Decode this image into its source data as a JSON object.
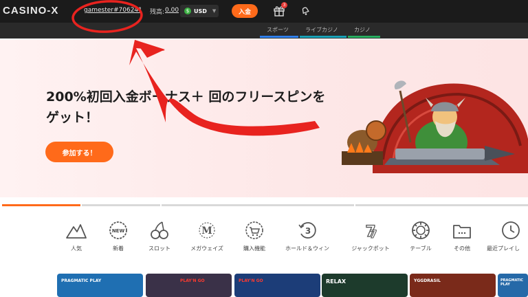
{
  "header": {
    "logo": "CASINO-X",
    "username": "gamester#706241",
    "balance_label": "残高:",
    "balance_value": "0.00",
    "currency_symbol": "$",
    "currency": "USD",
    "deposit_label": "入金",
    "gift_badge": "3"
  },
  "subnav": {
    "tabs": [
      {
        "label": "スポーツ",
        "color": "#2f80ed"
      },
      {
        "label": "ライブカジノ",
        "color": "#17a2b8"
      },
      {
        "label": "カジノ",
        "color": "#27ae60"
      }
    ]
  },
  "hero": {
    "title": "200%初回入金ボーナス＋ 回のフリースピンをゲット！",
    "cta_label": "参加する！",
    "slides": 4,
    "active_slide": 1
  },
  "categories": [
    {
      "label": "人気",
      "icon": "mountain-icon"
    },
    {
      "label": "新着",
      "icon": "new-badge-icon"
    },
    {
      "label": "スロット",
      "icon": "cherry-icon"
    },
    {
      "label": "メガウェイズ",
      "icon": "megaways-icon"
    },
    {
      "label": "購入機能",
      "icon": "cart-icon"
    },
    {
      "label": "ホールド＆ウィン",
      "icon": "hold-win-icon"
    },
    {
      "label": "ジャックポット",
      "icon": "jackpot-777-icon"
    },
    {
      "label": "テーブル",
      "icon": "chip-icon"
    },
    {
      "label": "その他",
      "icon": "folder-icon"
    },
    {
      "label": "最近プレイし",
      "icon": "history-clock-icon"
    }
  ],
  "games": [
    {
      "provider": "PRAGMATIC PLAY",
      "color": "#1f6fb2"
    },
    {
      "provider": "PLAY'N GO",
      "color": "#3a3148"
    },
    {
      "provider": "PLAY'N GO",
      "color": "#1c3d78"
    },
    {
      "provider": "RELAX",
      "color": "#1d3b2c"
    },
    {
      "provider": "YGGDRASIL",
      "color": "#7a2a1a"
    },
    {
      "provider": "PRAGMATIC PLAY",
      "color": "#2569a8"
    }
  ],
  "colors": {
    "accent": "#ff6a1a",
    "header_bg": "#1b1b1b",
    "annotation": "#e8231f"
  }
}
